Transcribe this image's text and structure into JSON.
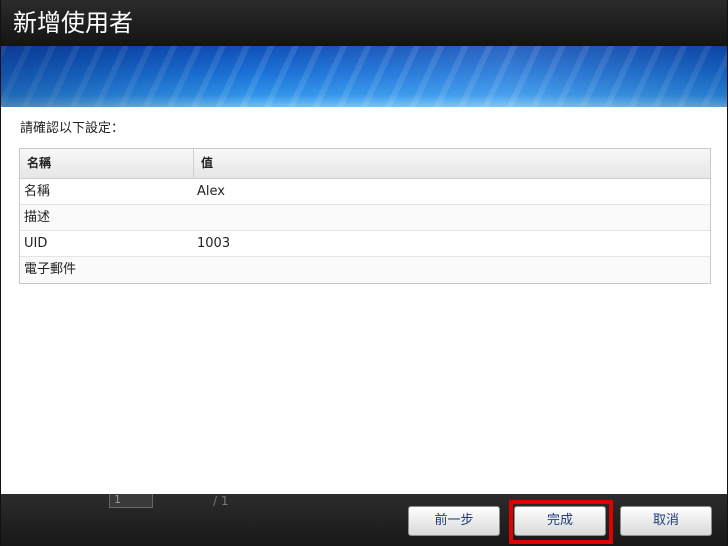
{
  "dialog": {
    "title": "新增使用者",
    "prompt": "請確認以下設定：",
    "table": {
      "headers": [
        "名稱",
        "值"
      ],
      "rows": [
        {
          "name": "名稱",
          "value": "Alex"
        },
        {
          "name": "描述",
          "value": ""
        },
        {
          "name": "UID",
          "value": "1003"
        },
        {
          "name": "電子郵件",
          "value": ""
        }
      ]
    },
    "buttons": {
      "prev": "前一步",
      "finish": "完成",
      "cancel": "取消"
    }
  },
  "background": {
    "pager_of": "/ 1",
    "page_value": "1"
  },
  "colors": {
    "highlight": "#e00000",
    "banner": "#1b73d8",
    "title_bar": "#1f1f1f"
  }
}
